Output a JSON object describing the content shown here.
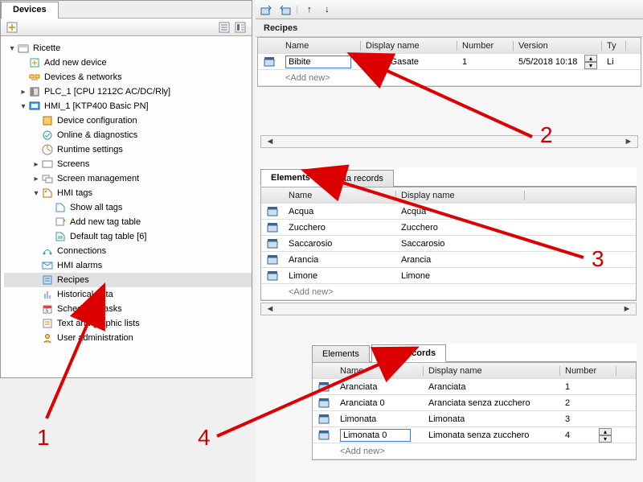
{
  "left": {
    "tab": "Devices",
    "root": "Ricette",
    "items": {
      "add_device": "Add new device",
      "devices_networks": "Devices & networks",
      "plc": "PLC_1 [CPU 1212C AC/DC/Rly]",
      "hmi": "HMI_1 [KTP400 Basic PN]",
      "device_conf": "Device configuration",
      "online_diag": "Online & diagnostics",
      "runtime": "Runtime settings",
      "screens": "Screens",
      "screen_mgmt": "Screen management",
      "hmi_tags": "HMI tags",
      "show_tags": "Show all tags",
      "add_tag": "Add new tag table",
      "def_tag": "Default tag table [6]",
      "connections": "Connections",
      "alarms": "HMI alarms",
      "recipes": "Recipes",
      "hist": "Historical data",
      "sched": "Scheduled tasks",
      "text_gfx": "Text and graphic lists",
      "user_admin": "User administration"
    }
  },
  "recipes": {
    "title": "Recipes",
    "headers": {
      "name": "Name",
      "display": "Display name",
      "number": "Number",
      "version": "Version",
      "ty": "Ty"
    },
    "row": {
      "name_edit": "Bibite",
      "display": "Bibite Gasate",
      "number": "1",
      "version": "5/5/2018 10:18",
      "ty": "Li"
    },
    "add_new": "<Add new>"
  },
  "elements": {
    "tab_el": "Elements",
    "tab_dr": "Data records",
    "headers": {
      "name": "Name",
      "display": "Display name"
    },
    "rows": [
      {
        "name": "Acqua",
        "display": "Acqua"
      },
      {
        "name": "Zucchero",
        "display": "Zucchero"
      },
      {
        "name": "Saccarosio",
        "display": "Saccarosio"
      },
      {
        "name": "Arancia",
        "display": "Arancia"
      },
      {
        "name": "Limone",
        "display": "Limone"
      }
    ],
    "add_new": "<Add new>"
  },
  "datarecords": {
    "tab_el": "Elements",
    "tab_dr": "Data records",
    "headers": {
      "name": "Name",
      "display": "Display name",
      "number": "Number"
    },
    "rows": [
      {
        "name": "Aranciata",
        "display": "Aranciata",
        "number": "1"
      },
      {
        "name": "Aranciata 0",
        "display": "Aranciata senza zucchero",
        "number": "2"
      },
      {
        "name": "Limonata",
        "display": "Limonata",
        "number": "3"
      },
      {
        "name": "Limonata 0",
        "display": "Limonata senza zucchero",
        "number": "4"
      }
    ],
    "add_new": "<Add new>"
  },
  "annotations": {
    "n1": "1",
    "n2": "2",
    "n3": "3",
    "n4": "4"
  }
}
